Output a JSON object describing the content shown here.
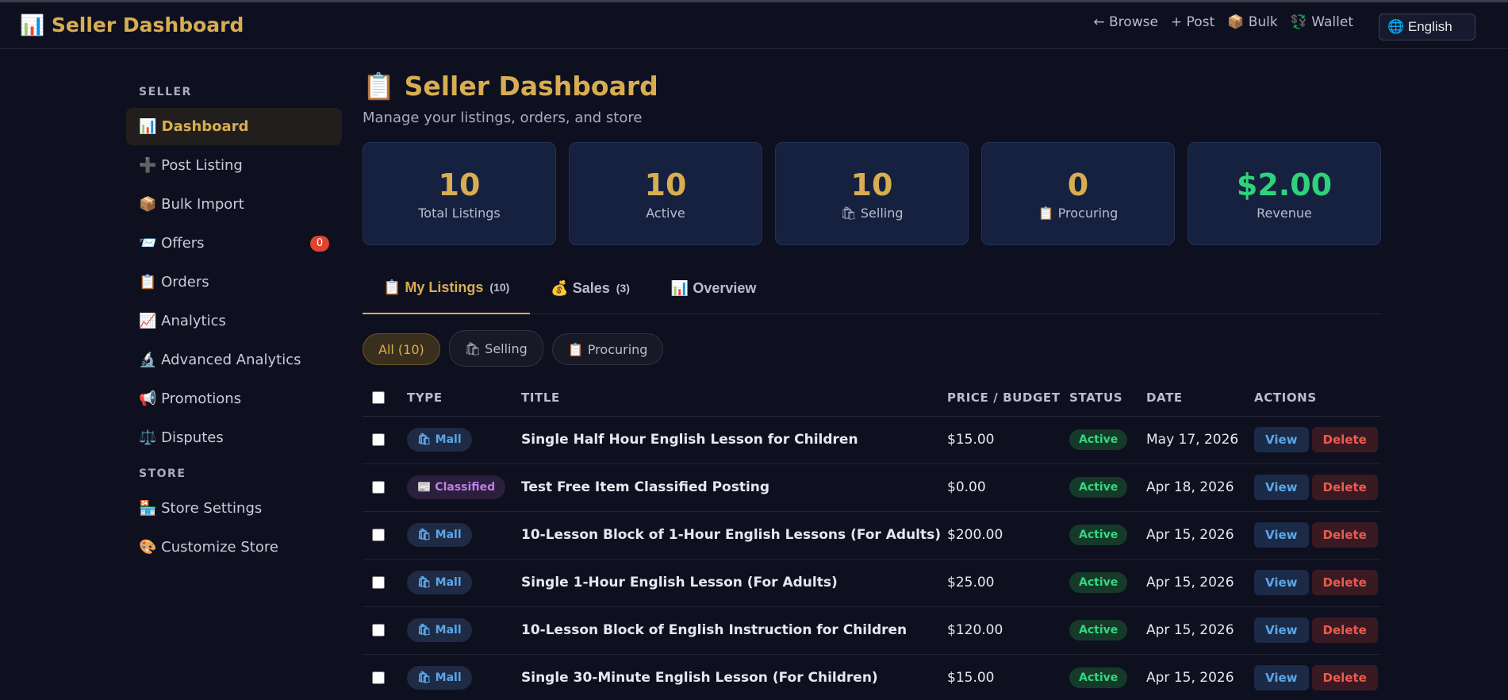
{
  "header": {
    "brand": "📊 Seller Dashboard",
    "nav": [
      "← Browse",
      "+ Post",
      "📦 Bulk",
      "💱 Wallet"
    ],
    "language": "🌐 English"
  },
  "sidebar": {
    "seller_section": "SELLER",
    "store_section": "STORE",
    "items": [
      {
        "label": "📊 Dashboard"
      },
      {
        "label": "➕ Post Listing"
      },
      {
        "label": "📦 Bulk Import"
      },
      {
        "label": "📨 Offers",
        "badge": "0"
      },
      {
        "label": "📋 Orders"
      },
      {
        "label": "📈 Analytics"
      },
      {
        "label": "🔬 Advanced Analytics"
      },
      {
        "label": "📢 Promotions"
      },
      {
        "label": "⚖️ Disputes"
      }
    ],
    "store_items": [
      {
        "label": "🏪 Store Settings"
      },
      {
        "label": "🎨 Customize Store"
      }
    ]
  },
  "main": {
    "title": "📋 Seller Dashboard",
    "subtitle": "Manage your listings, orders, and store",
    "stats": [
      {
        "value": "10",
        "label": "Total Listings"
      },
      {
        "value": "10",
        "label": "Active"
      },
      {
        "value": "10",
        "label": "🛍 Selling"
      },
      {
        "value": "0",
        "label": "📋 Procuring"
      },
      {
        "value": "$2.00",
        "label": "Revenue"
      }
    ],
    "tabs": [
      {
        "label": "📋 My Listings",
        "count": "(10)"
      },
      {
        "label": "💰 Sales",
        "count": "(3)"
      },
      {
        "label": "📊 Overview",
        "count": ""
      }
    ],
    "filters": [
      "All (10)",
      "🛍 Selling",
      "📋 Procuring"
    ],
    "table": {
      "headers": [
        "TYPE",
        "TITLE",
        "PRICE / BUDGET",
        "STATUS",
        "DATE",
        "ACTIONS"
      ],
      "view_label": "View",
      "delete_label": "Delete",
      "rows": [
        {
          "type": "🛍 Mall",
          "kind": "mall",
          "title": "Single Half Hour English Lesson for Children",
          "price": "$15.00",
          "status": "Active",
          "date": "May 17, 2026"
        },
        {
          "type": "📰 Classified",
          "kind": "classified",
          "title": "Test Free Item Classified Posting",
          "price": "$0.00",
          "status": "Active",
          "date": "Apr 18, 2026"
        },
        {
          "type": "🛍 Mall",
          "kind": "mall",
          "title": "10-Lesson Block of 1-Hour English Lessons (For Adults)",
          "price": "$200.00",
          "status": "Active",
          "date": "Apr 15, 2026"
        },
        {
          "type": "🛍 Mall",
          "kind": "mall",
          "title": "Single 1-Hour English Lesson (For Adults)",
          "price": "$25.00",
          "status": "Active",
          "date": "Apr 15, 2026"
        },
        {
          "type": "🛍 Mall",
          "kind": "mall",
          "title": "10-Lesson Block of English Instruction for Children",
          "price": "$120.00",
          "status": "Active",
          "date": "Apr 15, 2026"
        },
        {
          "type": "🛍 Mall",
          "kind": "mall",
          "title": "Single 30-Minute English Lesson (For Children)",
          "price": "$15.00",
          "status": "Active",
          "date": "Apr 15, 2026"
        }
      ]
    }
  }
}
